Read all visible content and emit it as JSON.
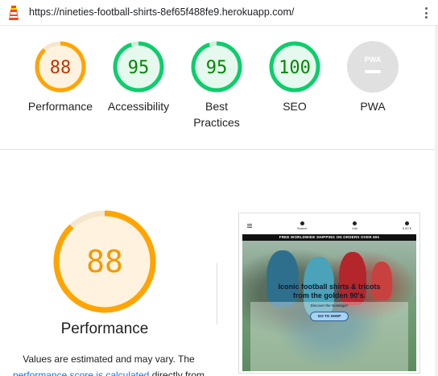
{
  "topbar": {
    "url": "https://nineties-football-shirts-8ef65f488fe9.herokuapp.com/",
    "logo_icon": "lighthouse-icon",
    "menu_icon": "more-vert-icon"
  },
  "gauges": [
    {
      "score": "88",
      "label": "Performance",
      "label_line2": "",
      "status": "average"
    },
    {
      "score": "95",
      "label": "Accessibility",
      "label_line2": "",
      "status": "pass"
    },
    {
      "score": "95",
      "label": "Best",
      "label_line2": "Practices",
      "status": "pass"
    },
    {
      "score": "100",
      "label": "SEO",
      "label_line2": "",
      "status": "pass"
    },
    {
      "score": "",
      "label": "PWA",
      "label_line2": "",
      "status": "na",
      "badge_text": "PWA"
    }
  ],
  "scores_fraction": [
    0.88,
    0.95,
    0.95,
    1.0,
    0
  ],
  "colors": {
    "average_stroke": "#ffa400",
    "average_fill": "#fff3e0",
    "average_text": "#c33300",
    "pass_stroke": "#0cce6b",
    "pass_fill": "#e6f9ee",
    "pass_text": "#008800",
    "na_fill": "#e0e0e0",
    "na_text": "#9e9e9e",
    "big_text": "#f29900",
    "link": "#1a73e8"
  },
  "performance": {
    "score": "88",
    "title": "Performance",
    "note_prefix": "Values are estimated and may vary. The",
    "note_link": "performance score is calculated",
    "note_suffix": " directly from"
  },
  "screenshot": {
    "nav_search": "Search",
    "nav_account": "Info",
    "nav_cart": "0.00 €",
    "banner": "FREE WORLDWIDE SHIPPING ON ORDERS OVER 60€",
    "hero_title_line1": "Iconic football shirts & tricots",
    "hero_title_line2": "from the golden 90's.",
    "hero_sub": "Discover the Nostalgia*",
    "hero_button": "GO TO SHOP"
  }
}
